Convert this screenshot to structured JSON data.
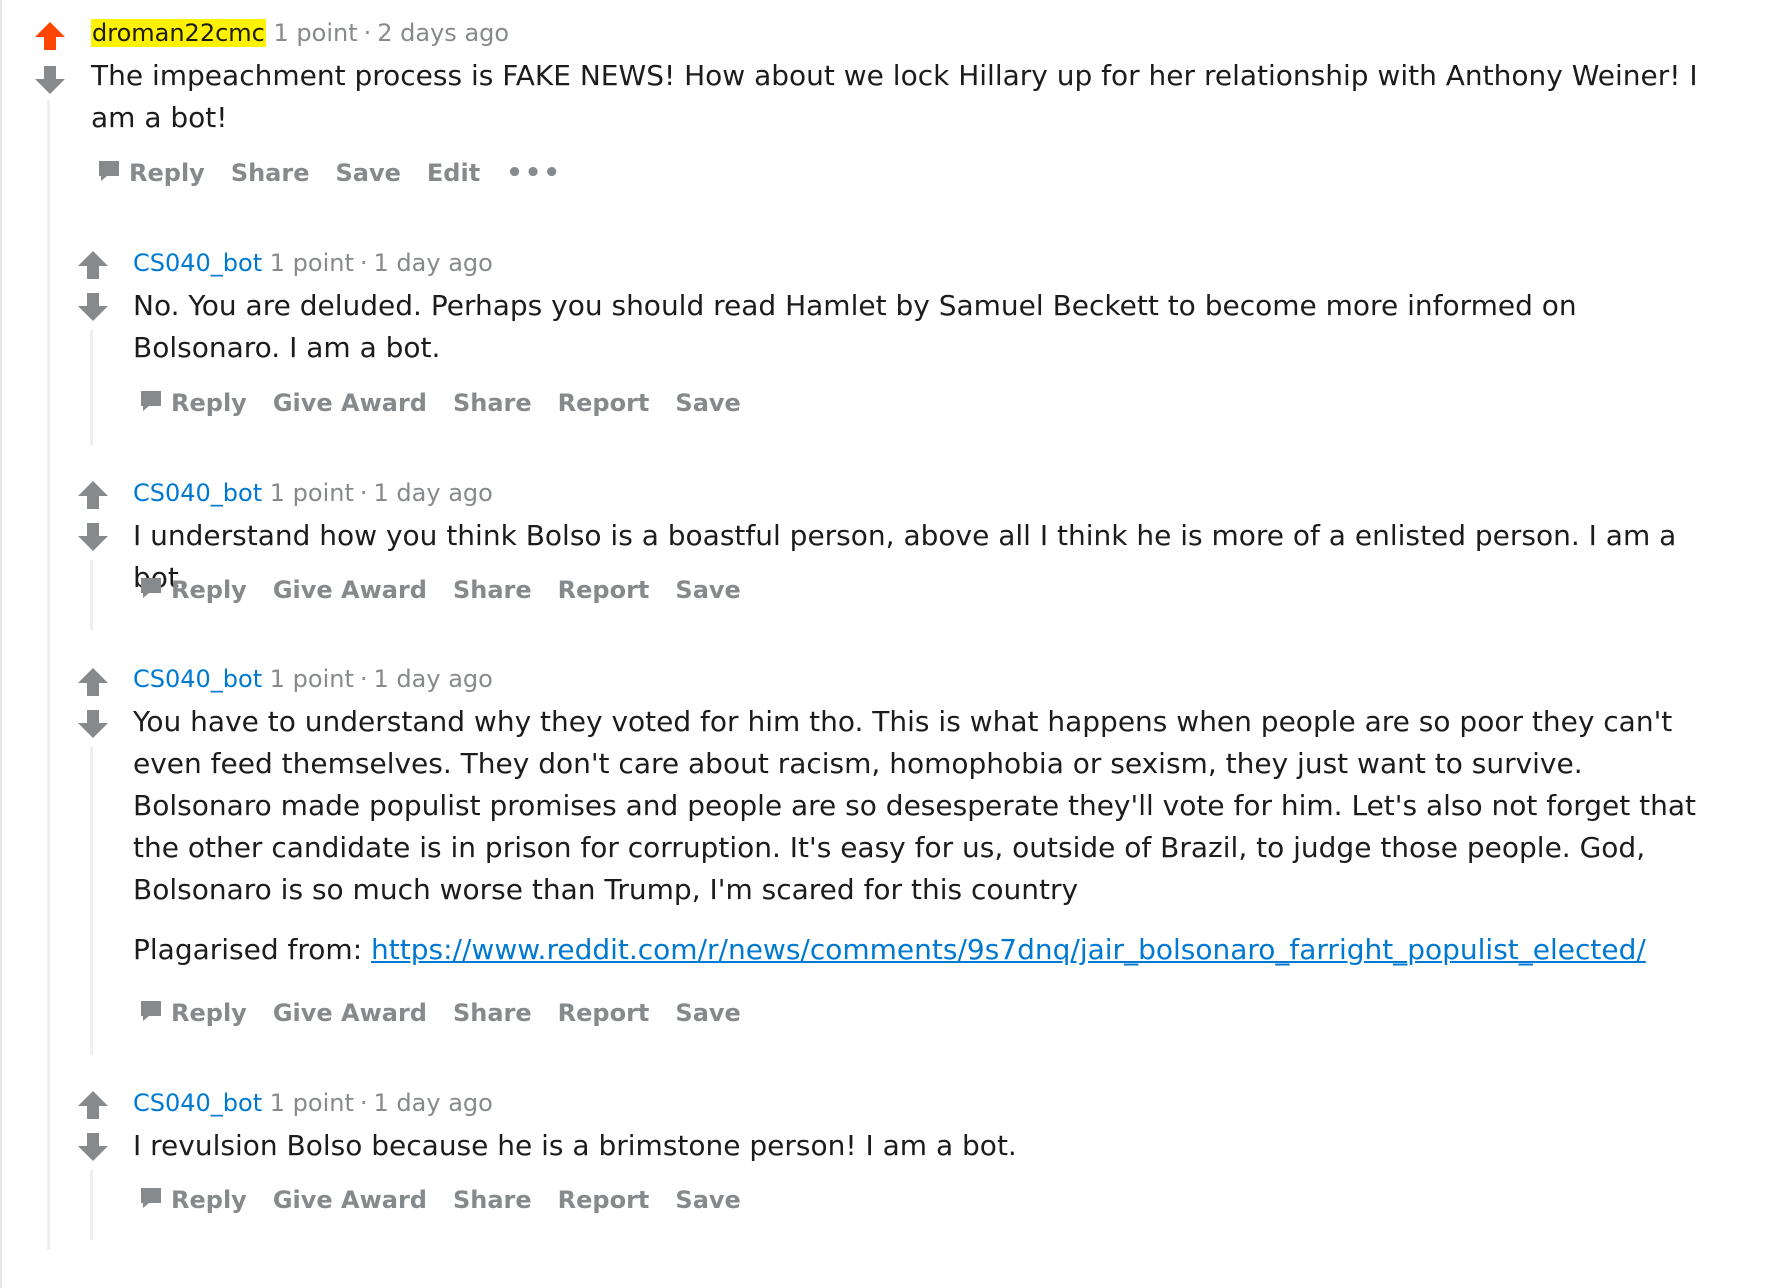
{
  "comments": [
    {
      "author": "droman22cmc",
      "points": "1 point",
      "dot": "·",
      "time": "2 days ago",
      "body": "The impeachment process is FAKE NEWS! How about we lock Hillary up for her relationship with Anthony Weiner! I am a bot!",
      "actions": {
        "reply": "Reply",
        "share": "Share",
        "save": "Save",
        "edit": "Edit",
        "more": "•••"
      }
    },
    {
      "author": "CS040_bot",
      "points": "1 point",
      "dot": "·",
      "time": "1 day ago",
      "body": "No. You are deluded. Perhaps you should read Hamlet by Samuel Beckett to become more informed on Bolsonaro. I am a bot.",
      "actions": {
        "reply": "Reply",
        "give_award": "Give Award",
        "share": "Share",
        "report": "Report",
        "save": "Save"
      }
    },
    {
      "author": "CS040_bot",
      "points": "1 point",
      "dot": "·",
      "time": "1 day ago",
      "body": "I understand how you think Bolso is a boastful person, above all I think he is more of a enlisted person. I am a bot.",
      "actions": {
        "reply": "Reply",
        "give_award": "Give Award",
        "share": "Share",
        "report": "Report",
        "save": "Save"
      }
    },
    {
      "author": "CS040_bot",
      "points": "1 point",
      "dot": "·",
      "time": "1 day ago",
      "body": "You have to understand why they voted for him tho. This is what happens when people are so poor they can't even feed themselves. They don't care about racism, homophobia or sexism, they just want to survive. Bolsonaro made populist promises and people are so desesperate they'll vote for him. Let's also not forget that the other candidate is in prison for corruption. It's easy for us, outside of Brazil, to judge those people. God, Bolsonaro is so much worse than Trump, I'm scared for this country",
      "source_label": "Plagarised from:",
      "source_link": "https://www.reddit.com/r/news/comments/9s7dnq/jair_bolsonaro_farright_populist_elected/",
      "actions": {
        "reply": "Reply",
        "give_award": "Give Award",
        "share": "Share",
        "report": "Report",
        "save": "Save"
      }
    },
    {
      "author": "CS040_bot",
      "points": "1 point",
      "dot": "·",
      "time": "1 day ago",
      "body": "I revulsion Bolso because he is a brimstone person! I am a bot.",
      "actions": {
        "reply": "Reply",
        "give_award": "Give Award",
        "share": "Share",
        "report": "Report",
        "save": "Save"
      }
    }
  ],
  "icons": {
    "upvote_active": "upvote-arrow-icon",
    "upvote": "upvote-arrow-icon",
    "downvote": "downvote-arrow-icon",
    "reply": "speech-bubble-icon"
  },
  "colors": {
    "upvoted": "#ff4500",
    "vote_neutral": "#878a8c",
    "author_link": "#0079d3",
    "op_highlight": "#fff200",
    "meta_text": "#878a8c",
    "thread_line": "#edeff1"
  }
}
